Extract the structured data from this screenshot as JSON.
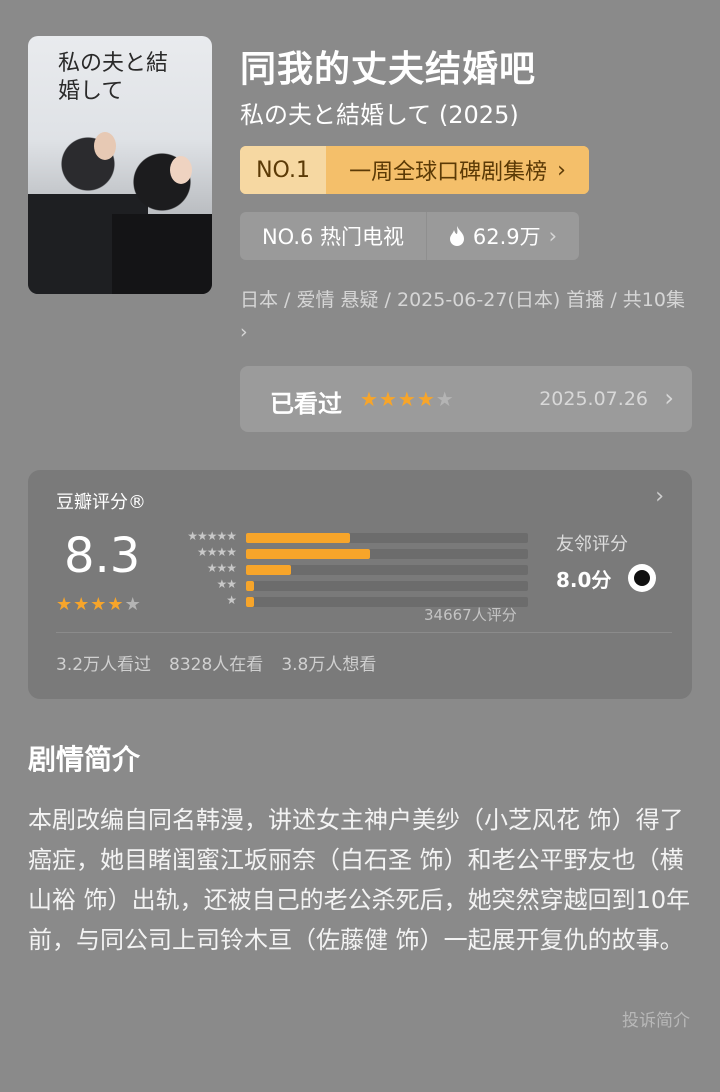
{
  "poster": {
    "title": "私の夫と結婚して"
  },
  "header": {
    "title": "同我的丈夫结婚吧",
    "subtitle": "私の夫と結婚して (2025)"
  },
  "badges": {
    "rank1_no": "NO.1",
    "rank1_text": "一周全球口碑剧集榜",
    "rank2_text": "NO.6 热门电视",
    "rank2_heat": "62.9万"
  },
  "meta": {
    "line": "日本 / 爱情 悬疑 / 2025-06-27(日本) 首播 / 共10集"
  },
  "watched": {
    "label": "已看过",
    "stars": 4,
    "date": "2025.07.26"
  },
  "rating": {
    "header": "豆瓣评分®",
    "score": "8.3",
    "stars": 4,
    "distribution": [
      {
        "label": "★★★★★",
        "pct": 37
      },
      {
        "label": "★★★★",
        "pct": 44
      },
      {
        "label": "★★★",
        "pct": 16
      },
      {
        "label": "★★",
        "pct": 3
      },
      {
        "label": "★",
        "pct": 3
      }
    ],
    "count": "34667人评分",
    "friends_label": "友邻评分",
    "friends_score": "8.0分",
    "stats": [
      "3.2万人看过",
      "8328人在看",
      "3.8万人想看"
    ]
  },
  "intro": {
    "title": "剧情简介",
    "text": "本剧改编自同名韩漫，讲述女主神户美纱（小芝风花 饰）得了癌症，她目睹闺蜜江坂丽奈（白石圣 饰）和老公平野友也（横山裕 饰）出轨，还被自己的老公杀死后，她突然穿越回到10年前，与同公司上司铃木亘（佐藤健 饰）一起展开复仇的故事。",
    "report": "投诉简介"
  },
  "colors": {
    "accent": "#f7a52a",
    "badge": "#f6c97a"
  }
}
